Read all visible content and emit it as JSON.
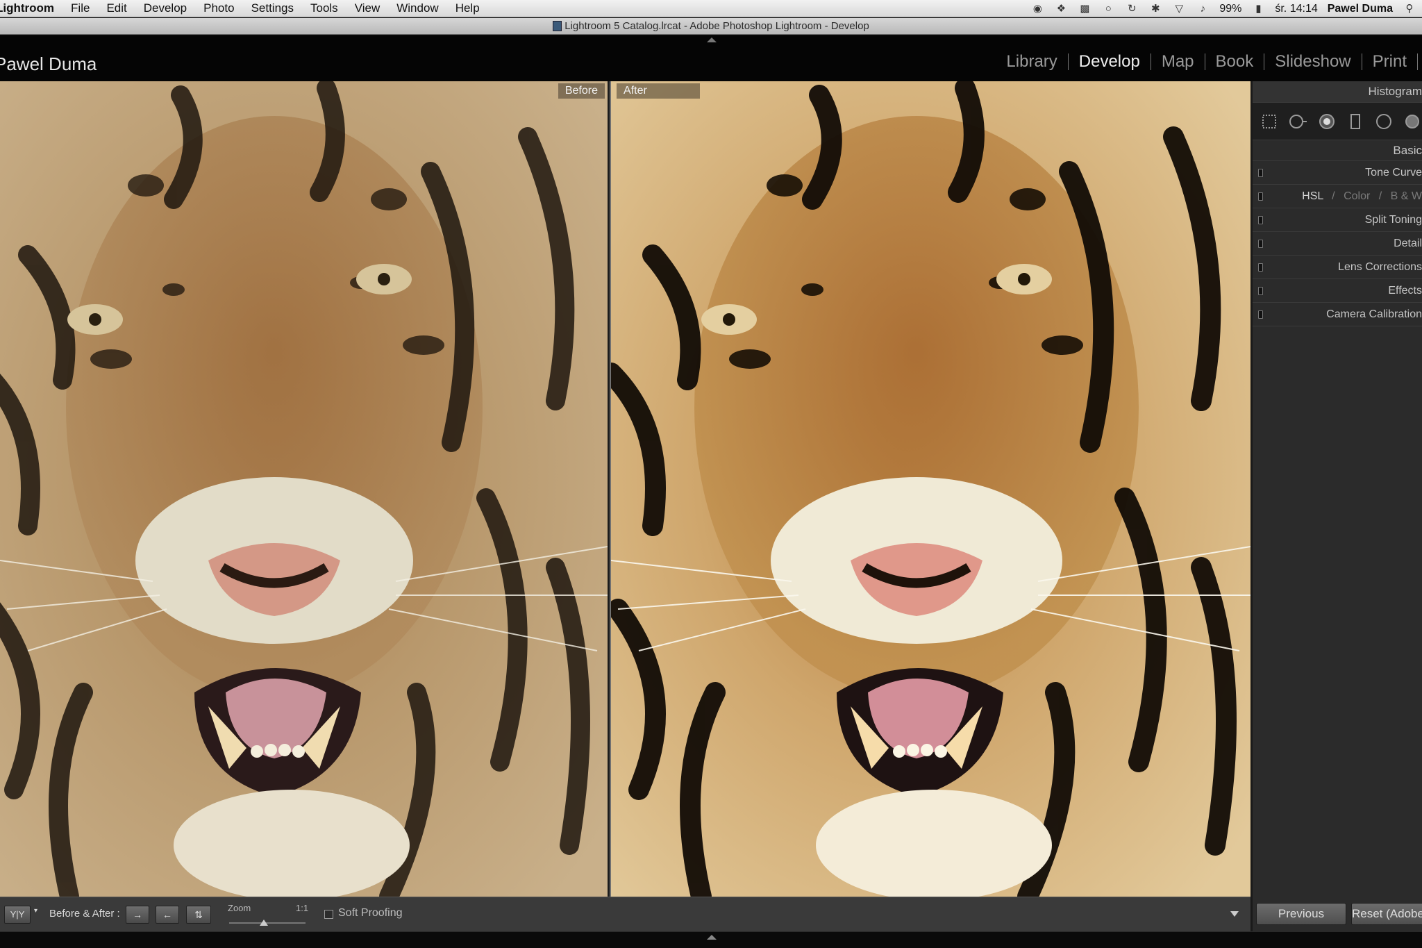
{
  "menubar": {
    "app_name": "Lightroom",
    "items": [
      "File",
      "Edit",
      "Develop",
      "Photo",
      "Settings",
      "Tools",
      "View",
      "Window",
      "Help"
    ],
    "battery": "99%",
    "clock": "śr. 14:14",
    "user": "Pawel Duma"
  },
  "window": {
    "title": "Lightroom 5 Catalog.lrcat - Adobe Photoshop Lightroom - Develop"
  },
  "identity_plate": "Pawel Duma",
  "modules": [
    {
      "label": "Library",
      "active": false
    },
    {
      "label": "Develop",
      "active": true
    },
    {
      "label": "Map",
      "active": false
    },
    {
      "label": "Book",
      "active": false
    },
    {
      "label": "Slideshow",
      "active": false
    },
    {
      "label": "Print",
      "active": false
    }
  ],
  "compare": {
    "before_label": "Before",
    "after_label": "After"
  },
  "right_panel": {
    "histogram": "Histogram",
    "tools": [
      "crop-overlay-icon",
      "spot-removal-icon",
      "red-eye-icon",
      "graduated-filter-icon",
      "radial-filter-icon",
      "adjustment-brush-icon"
    ],
    "basic": "Basic",
    "sections": {
      "tone_curve": "Tone Curve",
      "hsl": "HSL",
      "hsl_sep": "/",
      "hsl_color": "Color",
      "hsl_bw": "B & W",
      "split_toning": "Split Toning",
      "detail": "Detail",
      "lens_corrections": "Lens Corrections",
      "effects": "Effects",
      "camera_calibration": "Camera Calibration"
    },
    "previous_button": "Previous",
    "reset_button": "Reset (Adobe)"
  },
  "toolbar": {
    "view_mode": "Y|Y",
    "before_after_label": "Before & After :",
    "zoom_label": "Zoom",
    "zoom_ratio": "1:1",
    "zoom_level": 0.45,
    "soft_proofing": "Soft Proofing",
    "soft_proofing_checked": false
  },
  "colors": {
    "active_module": "#f0f0f0",
    "inactive_module": "#9a9a9a",
    "panel_bg": "#2b2b2b",
    "toolbar_bg": "#3a3a3a"
  }
}
